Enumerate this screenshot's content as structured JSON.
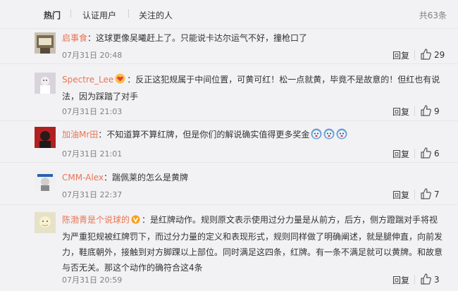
{
  "tabs": [
    {
      "label": "热门"
    },
    {
      "label": "认证用户"
    },
    {
      "label": "关注的人"
    }
  ],
  "total": "共63条",
  "comments": [
    {
      "user": "启事食",
      "sep": "：",
      "text": "这球更像吴曦赶上了。只能说卡达尔运气不好，撞枪口了",
      "time": "07月31日 20:48",
      "reply": "回复",
      "likes": "29"
    },
    {
      "user": "Spectre_Lee",
      "badge": "red-heart-badge",
      "sep": "：",
      "text": "反正这犯规属于中间位置，可黄可红！松一点就黄，毕竟不是故意的！但红也有说法，因为踩踏了对手",
      "time": "07月31日 21:03",
      "reply": "回复",
      "likes": "9"
    },
    {
      "user": "加油Mr田",
      "sep": "：",
      "text": "不知道算不算红牌，但是你们的解说确实值得更多奖金",
      "emojis": [
        "crying-face-icon",
        "crying-face-icon",
        "crying-face-icon"
      ],
      "time": "07月31日 21:01",
      "reply": "回复",
      "likes": "6"
    },
    {
      "user": "CMM-Alex",
      "sep": "：",
      "text": "踹佩莱的怎么是黄牌",
      "time": "07月31日 22:37",
      "reply": "回复",
      "likes": "7"
    },
    {
      "user": "陈渤青是个说球的",
      "badge": "orange-v-badge",
      "sep": "：",
      "text": "是红牌动作。规则原文表示使用过分力量是从前方，后方，侧方蹬踹对手将视为严重犯规被红牌罚下，而过分力量的定义和表现形式，规则同样做了明确阐述，就是腿伸直，向前发力，鞋底朝外，接触到对方脚踝以上部位。同时满足这四条，红牌。有一条不满足就可以黄牌。和故意与否无关。那这个动作的确符合这4条",
      "time": "07月31日 20:59",
      "reply": "回复",
      "likes": "3"
    }
  ],
  "colors": {
    "background": "#f2f2f5",
    "username": "#eb7350",
    "meta": "#808080",
    "divider": "#e6e6e6"
  }
}
